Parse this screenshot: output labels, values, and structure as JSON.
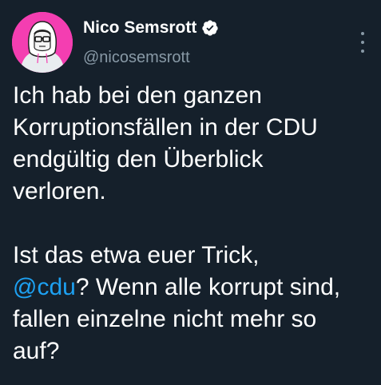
{
  "user": {
    "display_name": "Nico Semsrott",
    "handle": "@nicosemsrott",
    "verified": true,
    "avatar_bg": "#f43eb1"
  },
  "more_icon": "more-vertical-icon",
  "tweet": {
    "para1": {
      "line1": "Ich hab bei den ganzen",
      "line2": "Korruptionsfällen in der CDU",
      "line3": "endgültig den Überblick",
      "line4": "verloren."
    },
    "para2": {
      "line1": "Ist das etwa euer Trick,",
      "mention": "@cdu",
      "line2_rest": "? Wenn alle korrupt sind,",
      "line3": "fallen einzelne nicht mehr so",
      "line4": "auf?"
    }
  },
  "colors": {
    "background": "#15202b",
    "text": "#ffffff",
    "muted": "#8899a6",
    "link": "#1da1f2"
  }
}
